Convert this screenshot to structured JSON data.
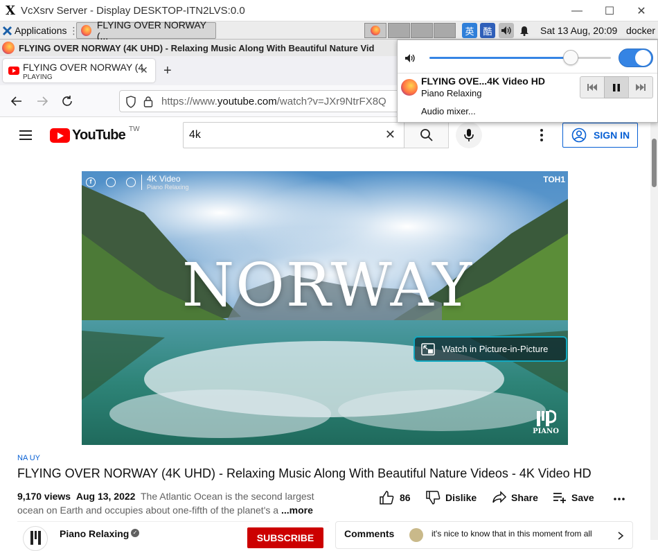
{
  "window": {
    "title": "VcXsrv Server - Display DESKTOP-ITN2LVS:0.0",
    "controls": {
      "minimize": "—",
      "maximize": "☐",
      "close": "✕"
    }
  },
  "panel": {
    "applications_label": "Applications",
    "task_label": "FLYING OVER NORWAY (...",
    "tray": {
      "input_method_1": "英",
      "input_method_2": "酷"
    },
    "clock": "Sat 13 Aug, 20:09",
    "user": "docker"
  },
  "firefox": {
    "window_title": "FLYING OVER NORWAY (4K UHD) - Relaxing Music Along With Beautiful Nature Vid",
    "tab": {
      "title": "FLYING OVER NORWAY (4",
      "subtitle": "PLAYING"
    },
    "url": {
      "prefix": "https://www.",
      "domain": "youtube.com",
      "path": "/watch?v=JXr9NtrFX8Q"
    }
  },
  "youtube": {
    "logo_text": "YouTube",
    "region": "TW",
    "search_value": "4k",
    "sign_in": "SIGN IN",
    "video": {
      "overlay_channel": "4K Video",
      "overlay_sub": "Piano Relaxing",
      "overlay_title": "NORWAY",
      "corner_brand": "PIANO",
      "top_right_mark": "TOH1",
      "pip_label": "Watch in Picture-in-Picture"
    },
    "tag": "NA UY",
    "title": "FLYING OVER NORWAY (4K UHD) - Relaxing Music Along With Beautiful Nature Videos - 4K Video HD",
    "views": "9,170 views",
    "date": "Aug 13, 2022",
    "description_1": "The Atlantic Ocean is the second largest",
    "description_2": "ocean on Earth and occupies about one-fifth of the planet's a",
    "more": "...more",
    "likes": "86",
    "dislike": "Dislike",
    "share": "Share",
    "save": "Save",
    "channel": "Piano Relaxing",
    "subscribe": "SUBSCRIBE",
    "comments_label": "Comments",
    "comment_preview": "it's nice to know that in this moment from all"
  },
  "audio_popup": {
    "volume_percent": 78,
    "track_title": "FLYING OVE...4K Video HD",
    "track_artist": "Piano Relaxing",
    "mixer": "Audio mixer..."
  }
}
